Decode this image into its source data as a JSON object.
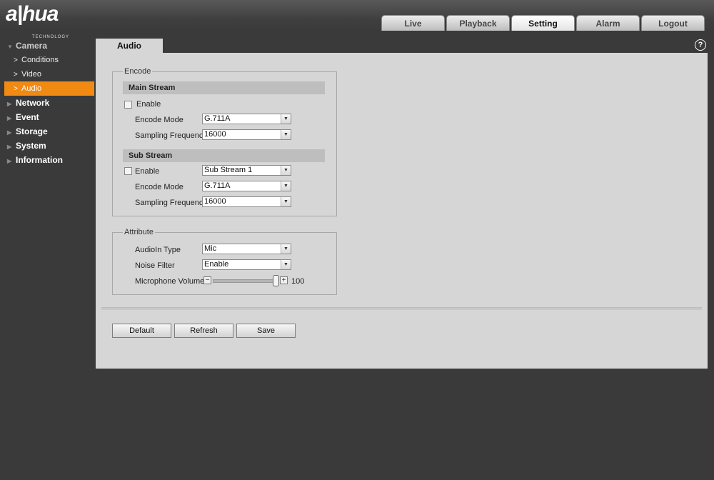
{
  "brand": {
    "logo": "a|hua",
    "logo_sub": "TECHNOLOGY"
  },
  "nav": {
    "tabs": [
      {
        "label": "Live"
      },
      {
        "label": "Playback"
      },
      {
        "label": "Setting"
      },
      {
        "label": "Alarm"
      },
      {
        "label": "Logout"
      }
    ],
    "active": "Setting"
  },
  "sidebar": {
    "camera": "Camera",
    "camera_items": [
      "Conditions",
      "Video",
      "Audio"
    ],
    "network": "Network",
    "event": "Event",
    "storage": "Storage",
    "system": "System",
    "information": "Information",
    "active_color": "#f08a12"
  },
  "page": {
    "tab": "Audio",
    "help": "?"
  },
  "encode": {
    "legend": "Encode",
    "main": {
      "title": "Main Stream",
      "enable_label": "Enable",
      "mode_label": "Encode Mode",
      "mode_value": "G.711A",
      "freq_label": "Sampling Frequency",
      "freq_value": "16000"
    },
    "sub": {
      "title": "Sub Stream",
      "enable_label": "Enable",
      "stream_value": "Sub Stream 1",
      "mode_label": "Encode Mode",
      "mode_value": "G.711A",
      "freq_label": "Sampling Frequency",
      "freq_value": "16000"
    }
  },
  "attribute": {
    "legend": "Attribute",
    "audioin_label": "AudioIn Type",
    "audioin_value": "Mic",
    "noise_label": "Noise Filter",
    "noise_value": "Enable",
    "volume_label": "Microphone Volume",
    "volume_value": "100",
    "minus": "−",
    "plus": "+"
  },
  "buttons": {
    "default": "Default",
    "refresh": "Refresh",
    "save": "Save"
  }
}
